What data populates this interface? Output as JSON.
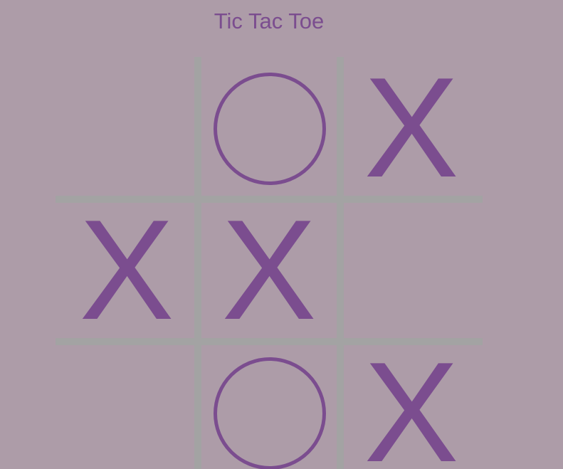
{
  "title": "Tic Tac Toe",
  "colors": {
    "background": "#ad9ca8",
    "mark": "#7b4d8f",
    "title": "#7b4d8f",
    "grid": "#a3a3a3"
  },
  "board": {
    "rows": 3,
    "cols": 3,
    "cells": [
      "",
      "O",
      "X",
      "X",
      "X",
      "",
      "",
      "O",
      "X"
    ]
  }
}
